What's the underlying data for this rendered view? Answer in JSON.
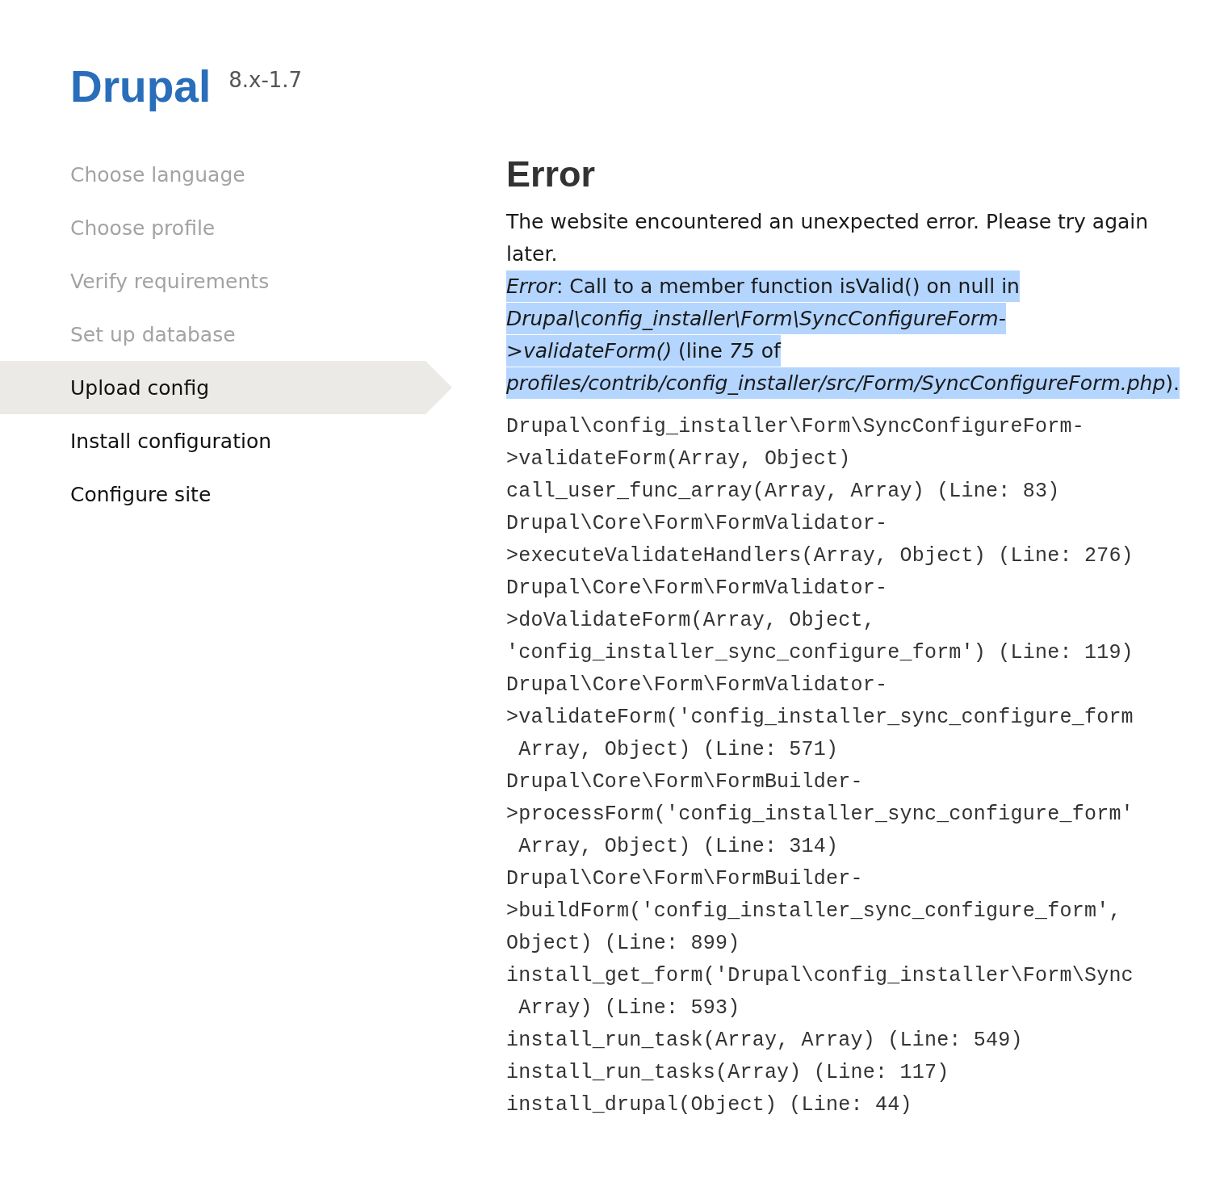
{
  "header": {
    "site_name": "Drupal",
    "version": "8.x-1.7"
  },
  "steps": [
    {
      "label": "Choose language",
      "completed": true,
      "selected": false
    },
    {
      "label": "Choose profile",
      "completed": true,
      "selected": false
    },
    {
      "label": "Verify requirements",
      "completed": true,
      "selected": false
    },
    {
      "label": "Set up database",
      "completed": true,
      "selected": false
    },
    {
      "label": "Upload config",
      "completed": false,
      "selected": true
    },
    {
      "label": "Install configuration",
      "completed": false,
      "selected": false
    },
    {
      "label": "Configure site",
      "completed": false,
      "selected": false
    }
  ],
  "error": {
    "title": "Error",
    "intro": "The website encountered an unexpected error. Please try again later.",
    "message": {
      "text": "*Error*: Call to a member function isValid() on null in *Drupal\\config_installer\\Form\\SyncConfigureForm->validateForm()* (line *75* of *profiles/contrib/config_installer/src/Form/SyncConfigureForm.php*).",
      "highlighted": true
    },
    "trace_lines": [
      "Drupal\\config_installer\\Form\\SyncConfigureForm-",
      ">validateForm(Array, Object)",
      "call_user_func_array(Array, Array) (Line: 83)",
      "Drupal\\Core\\Form\\FormValidator-",
      ">executeValidateHandlers(Array, Object) (Line: 276)",
      "Drupal\\Core\\Form\\FormValidator-",
      ">doValidateForm(Array, Object,",
      "'config_installer_sync_configure_form') (Line: 119)",
      "Drupal\\Core\\Form\\FormValidator-",
      ">validateForm('config_installer_sync_configure_form",
      " Array, Object) (Line: 571)",
      "Drupal\\Core\\Form\\FormBuilder-",
      ">processForm('config_installer_sync_configure_form'",
      " Array, Object) (Line: 314)",
      "Drupal\\Core\\Form\\FormBuilder-",
      ">buildForm('config_installer_sync_configure_form',",
      "Object) (Line: 899)",
      "install_get_form('Drupal\\config_installer\\Form\\Sync",
      " Array) (Line: 593)",
      "install_run_task(Array, Array) (Line: 549)",
      "install_run_tasks(Array) (Line: 117)",
      "install_drupal(Object) (Line: 44)"
    ]
  }
}
